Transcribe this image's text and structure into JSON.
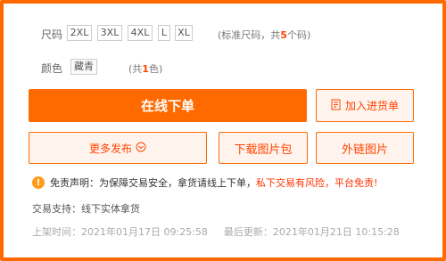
{
  "size_row": {
    "label": "尺码",
    "options": [
      "2XL",
      "3XL",
      "4XL",
      "L",
      "XL"
    ],
    "note_prefix": "(标准尺码，共",
    "note_count": "5",
    "note_suffix": "个码)"
  },
  "color_row": {
    "label": "颜色",
    "options": [
      "藏青"
    ],
    "note_prefix": "(共",
    "note_count": "1",
    "note_suffix": "色)"
  },
  "actions": {
    "order_online": "在线下单",
    "add_to_list": "加入进货单",
    "more_publish": "更多发布",
    "download_images": "下载图片包",
    "external_images": "外链图片"
  },
  "disclaimer": {
    "icon": "!",
    "text": "免责声明：为保障交易安全，拿货请线上下单，",
    "risk": "私下交易有风险，平台免责!"
  },
  "support": {
    "text": "交易支持：线下实体拿货"
  },
  "times": {
    "listed_label": "上架时间：",
    "listed_value": "2021年01月17日 09:25:58",
    "updated_label": "最后更新：",
    "updated_value": "2021年01月21日 10:15:28"
  },
  "colors": {
    "accent": "#ff6a00",
    "risk_text": "#ff3300",
    "warning_icon": "#ff9a1a"
  }
}
